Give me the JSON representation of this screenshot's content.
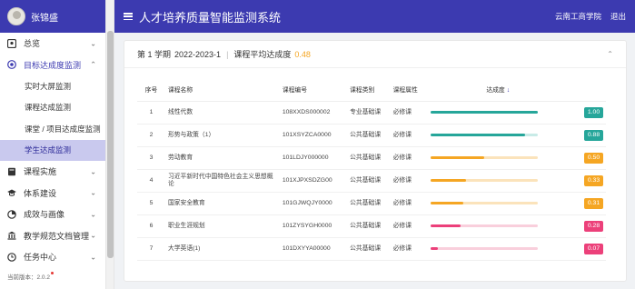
{
  "sidebar": {
    "user_name": "张锦盛",
    "items": [
      {
        "label": "总览",
        "icon": "dashboard-icon"
      },
      {
        "label": "目标达成度监测",
        "icon": "target-icon",
        "open": true,
        "children": [
          {
            "label": "实时大屏监测"
          },
          {
            "label": "课程达成监测"
          },
          {
            "label": "课堂 / 项目达成度监测"
          },
          {
            "label": "学生达成监测",
            "active": true
          }
        ]
      },
      {
        "label": "课程实施",
        "icon": "book-icon"
      },
      {
        "label": "体系建设",
        "icon": "graduation-cap-icon"
      },
      {
        "label": "成效与画像",
        "icon": "pie-chart-icon"
      },
      {
        "label": "教学规范文档管理",
        "icon": "building-icon"
      },
      {
        "label": "任务中心",
        "icon": "clock-icon"
      }
    ],
    "version": "当前版本：2.0.2"
  },
  "header": {
    "title": "人才培养质量智能监测系统",
    "school": "云南工商学院",
    "logout": "退出"
  },
  "card": {
    "term": "第 1 学期",
    "year": "2022-2023-1",
    "avg_label": "课程平均达成度",
    "avg_value": "0.48",
    "columns": {
      "no": "序号",
      "name": "课程名称",
      "code": "课程编号",
      "category": "课程类别",
      "attr": "课程属性",
      "rate": "达成度"
    },
    "rows": [
      {
        "no": "1",
        "name": "线性代数",
        "code": "108XXDS000002",
        "category": "专业基础课",
        "attr": "必修课",
        "rate": "1.00",
        "value": 1.0,
        "color": "#26a69a",
        "track": "#c8ebe7"
      },
      {
        "no": "2",
        "name": "形势与政策（1）",
        "code": "101XSYZCA0000",
        "category": "公共基础课",
        "attr": "必修课",
        "rate": "0.88",
        "value": 0.88,
        "color": "#26a69a",
        "track": "#c8ebe7"
      },
      {
        "no": "3",
        "name": "劳动教育",
        "code": "101LDJY000000",
        "category": "公共基础课",
        "attr": "必修课",
        "rate": "0.50",
        "value": 0.5,
        "color": "#f5a623",
        "track": "#fbe3bb"
      },
      {
        "no": "4",
        "name": "习近平新时代中国特色社会主义思想概论",
        "code": "101XJPXSDZG00",
        "category": "公共基础课",
        "attr": "必修课",
        "rate": "0.33",
        "value": 0.33,
        "color": "#f5a623",
        "track": "#fbe3bb"
      },
      {
        "no": "5",
        "name": "国家安全教育",
        "code": "101GJWQJY0000",
        "category": "公共基础课",
        "attr": "必修课",
        "rate": "0.31",
        "value": 0.31,
        "color": "#f5a623",
        "track": "#fbe3bb"
      },
      {
        "no": "6",
        "name": "职业生涯规划",
        "code": "101ZYSYGH0000",
        "category": "公共基础课",
        "attr": "必修课",
        "rate": "0.28",
        "value": 0.28,
        "color": "#ec407a",
        "track": "#f9cfdc"
      },
      {
        "no": "7",
        "name": "大学英语(1)",
        "code": "101DXYYA00000",
        "category": "公共基础课",
        "attr": "必修课",
        "rate": "0.07",
        "value": 0.07,
        "color": "#ec407a",
        "track": "#f9cfdc"
      }
    ]
  }
}
